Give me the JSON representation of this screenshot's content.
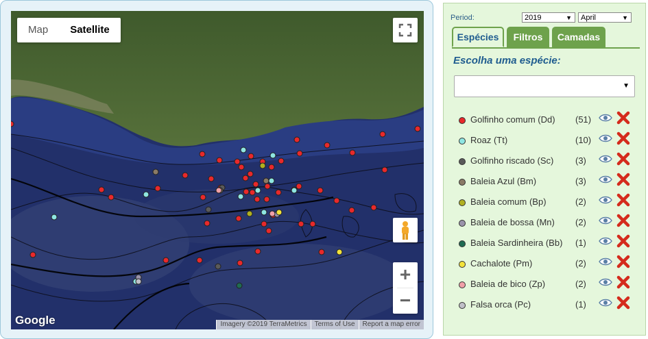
{
  "map": {
    "type_buttons": [
      {
        "label": "Map",
        "active": false
      },
      {
        "label": "Satellite",
        "active": true
      }
    ],
    "logo": "Google",
    "attribution": [
      "Imagery ©2019 TerraMetrics",
      "Terms of Use",
      "Report a map error"
    ],
    "zoom_in": "+",
    "zoom_out": "−",
    "icons": {
      "fullscreen": "fullscreen-icon",
      "streetview": "pegman-icon"
    }
  },
  "sidebar": {
    "period_label": "Period:",
    "year": "2019",
    "month": "April",
    "tabs": [
      {
        "label": "Espécies",
        "active": true
      },
      {
        "label": "Filtros",
        "active": false
      },
      {
        "label": "Camadas",
        "active": false
      }
    ],
    "heading": "Escolha uma espécie:",
    "species_select_value": "",
    "species": [
      {
        "name": "Golfinho comum (Dd)",
        "count": "(51)",
        "color": "#e8292b"
      },
      {
        "name": "Roaz (Tt)",
        "count": "(10)",
        "color": "#8ee6e2"
      },
      {
        "name": "Golfinho riscado (Sc)",
        "count": "(3)",
        "color": "#5a5a5a"
      },
      {
        "name": "Baleia Azul (Bm)",
        "count": "(3)",
        "color": "#8a7a66"
      },
      {
        "name": "Baleia comum (Bp)",
        "count": "(2)",
        "color": "#b0b020"
      },
      {
        "name": "Baleia de bossa (Mn)",
        "count": "(2)",
        "color": "#9a93aa"
      },
      {
        "name": "Baleia Sardinheira (Bb)",
        "count": "(1)",
        "color": "#1f6b52"
      },
      {
        "name": "Cachalote (Pm)",
        "count": "(2)",
        "color": "#f2e23a"
      },
      {
        "name": "Baleia de bico (Zp)",
        "count": "(2)",
        "color": "#f0a0a8"
      },
      {
        "name": "Falsa orca (Pc)",
        "count": "(1)",
        "color": "#c0c0c8"
      }
    ]
  }
}
